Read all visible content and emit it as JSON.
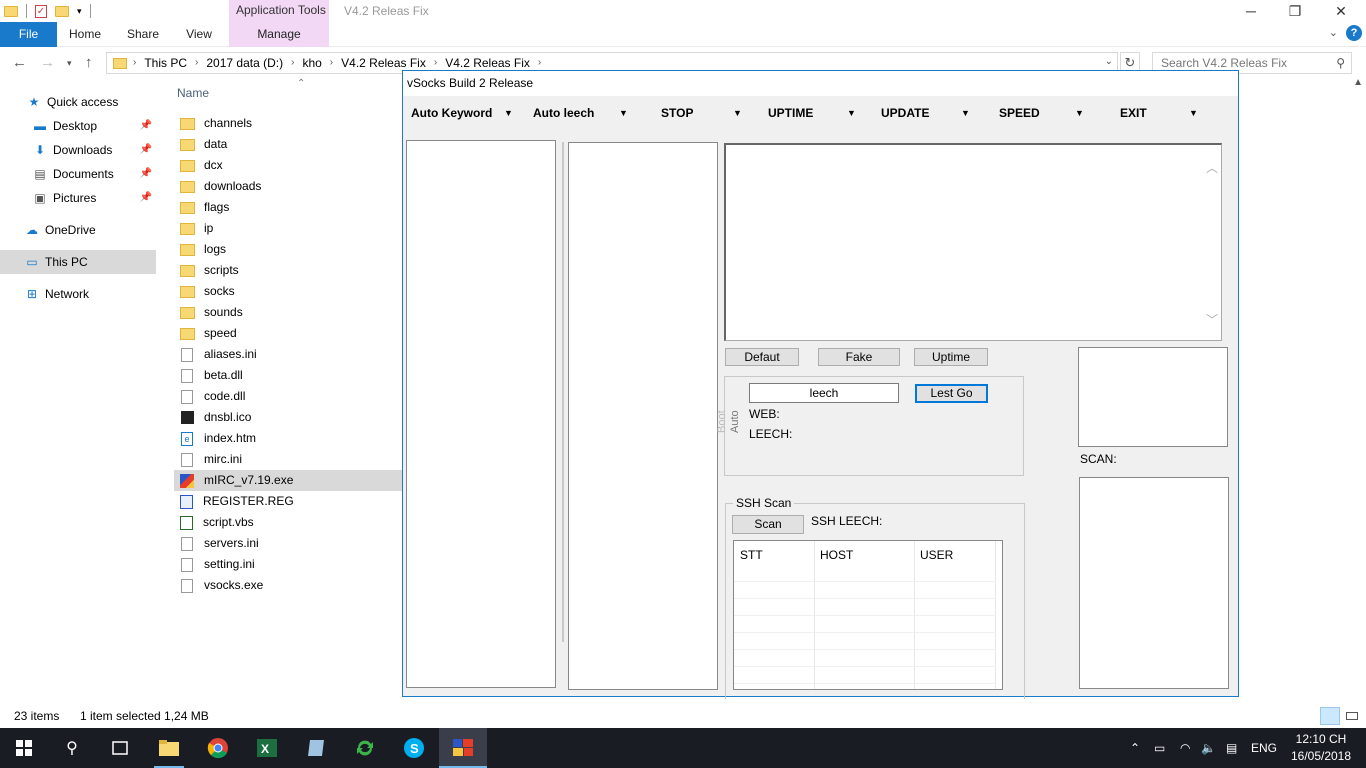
{
  "explorer": {
    "ribbon_context": "Application Tools",
    "window_title": "V4.2 Releas Fix",
    "tabs": [
      "File",
      "Home",
      "Share",
      "View",
      "Manage"
    ],
    "breadcrumbs": [
      "This PC",
      "2017 data (D:)",
      "kho",
      "V4.2 Releas Fix",
      "V4.2 Releas Fix"
    ],
    "search_placeholder": "Search V4.2 Releas Fix",
    "column_name": "Name",
    "nav": {
      "quick_access": "Quick access",
      "desktop": "Desktop",
      "downloads": "Downloads",
      "documents": "Documents",
      "pictures": "Pictures",
      "onedrive": "OneDrive",
      "this_pc": "This PC",
      "network": "Network"
    },
    "files": [
      {
        "name": "channels",
        "type": "folder"
      },
      {
        "name": "data",
        "type": "folder"
      },
      {
        "name": "dcx",
        "type": "folder"
      },
      {
        "name": "downloads",
        "type": "folder"
      },
      {
        "name": "flags",
        "type": "folder"
      },
      {
        "name": "ip",
        "type": "folder"
      },
      {
        "name": "logs",
        "type": "folder"
      },
      {
        "name": "scripts",
        "type": "folder"
      },
      {
        "name": "socks",
        "type": "folder"
      },
      {
        "name": "sounds",
        "type": "folder"
      },
      {
        "name": "speed",
        "type": "folder"
      },
      {
        "name": "aliases.ini",
        "type": "file"
      },
      {
        "name": "beta.dll",
        "type": "file"
      },
      {
        "name": "code.dll",
        "type": "file"
      },
      {
        "name": "dnsbl.ico",
        "type": "ico"
      },
      {
        "name": "index.htm",
        "type": "htm"
      },
      {
        "name": "mirc.ini",
        "type": "file"
      },
      {
        "name": "mIRC_v7.19.exe",
        "type": "exe"
      },
      {
        "name": "REGISTER.REG",
        "type": "reg"
      },
      {
        "name": "script.vbs",
        "type": "vbs"
      },
      {
        "name": "servers.ini",
        "type": "file"
      },
      {
        "name": "setting.ini",
        "type": "file"
      },
      {
        "name": "vsocks.exe",
        "type": "file"
      }
    ],
    "status": {
      "items": "23 items",
      "selected": "1 item selected  1,24 MB"
    }
  },
  "vsocks": {
    "title": "vSocks Build 2 Release",
    "menu": [
      "Auto Keyword",
      "Auto leech",
      "STOP",
      "UPTIME",
      "UPDATE",
      "SPEED",
      "EXIT"
    ],
    "buttons": {
      "defaut": "Defaut",
      "fake": "Fake",
      "uptime": "Uptime",
      "lest_go": "Lest Go",
      "scan": "Scan"
    },
    "auto_panel": {
      "input_value": "leech",
      "web_label": "WEB:",
      "leech_label": "LEECH:",
      "side_label": "Auto",
      "side_label2": "Boot"
    },
    "scan_label": "SCAN:",
    "ssh": {
      "group_title": "SSH Scan",
      "leech_label": "SSH LEECH:",
      "columns": [
        "STT",
        "HOST",
        "USER"
      ]
    }
  },
  "taskbar": {
    "lang": "ENG",
    "time": "12:10 CH",
    "date": "16/05/2018"
  },
  "colors": {
    "accent": "#1979ca",
    "context_tab": "#f2d8f5",
    "taskbar": "#1a1c24"
  }
}
